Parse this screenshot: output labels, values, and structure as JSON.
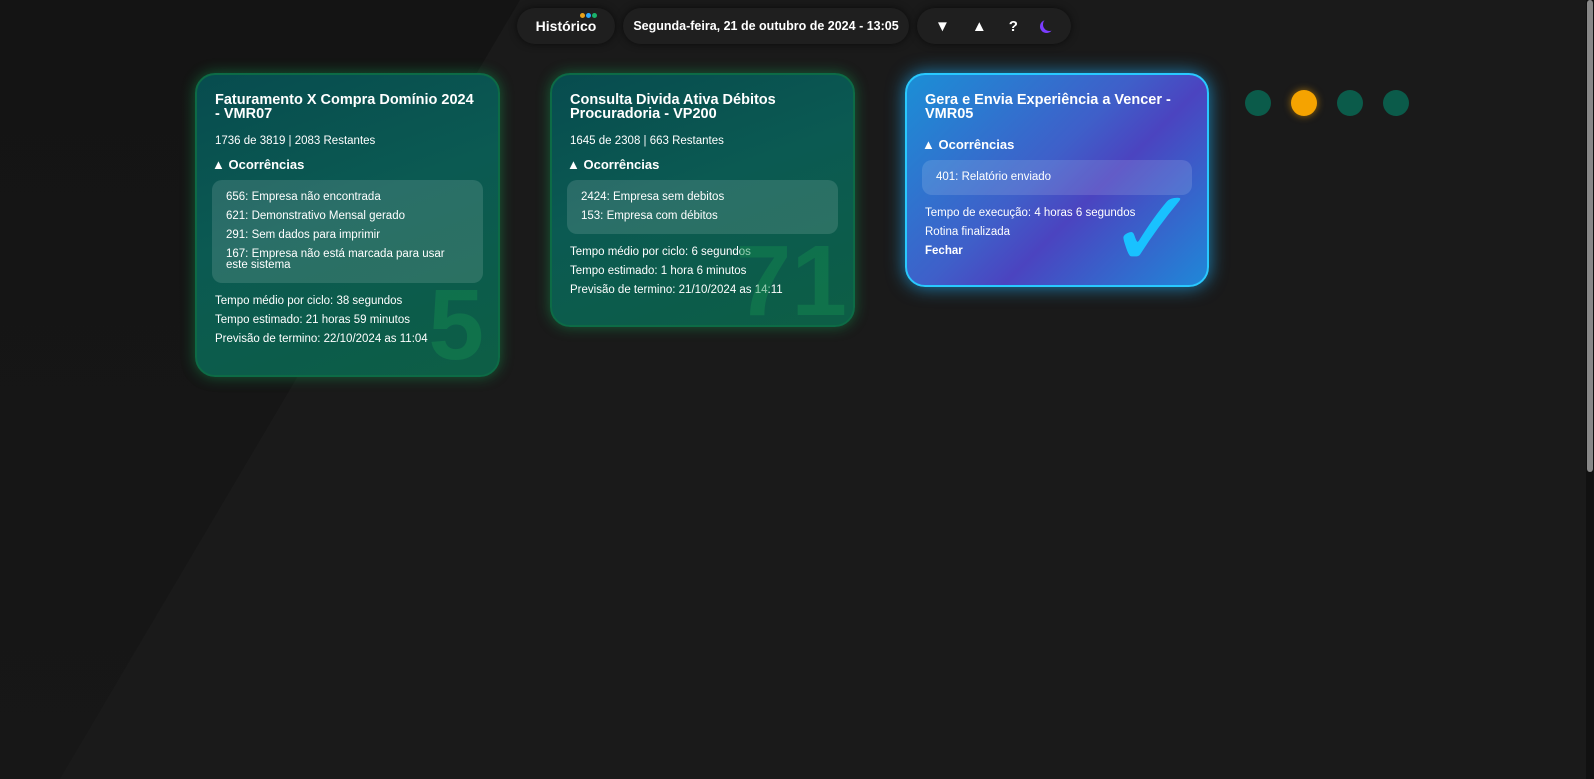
{
  "header": {
    "historico_label": "Histórico",
    "historico_dot_colors": [
      "#e8a21a",
      "#2aa8ff",
      "#19b36b"
    ],
    "date_label": "Segunda-feira, 21 de outubro de 2024 - 13:05",
    "tools": {
      "down": "▼",
      "up": "▲",
      "help": "?",
      "theme_icon": "moon-icon"
    }
  },
  "cards": [
    {
      "title": "Faturamento X Compra Domínio 2024 - VMR07",
      "count": "1736 de 3819 | 2083 Restantes",
      "occurrences_label": "▲ Ocorrências",
      "occurrences": [
        "656: Empresa não encontrada",
        "621: Demonstrativo Mensal gerado",
        "291: Sem dados para imprimir",
        "167: Empresa não está marcada para usar este sistema"
      ],
      "avg_cycle": "Tempo médio por ciclo: 38 segundos",
      "estimated": "Tempo estimado: 21 horas 59 minutos",
      "forecast": "Previsão de termino: 22/10/2024 as 11:04",
      "watermark": "5"
    },
    {
      "title": "Consulta Divida Ativa Débitos Procuradoria - VP200",
      "count": "1645 de 2308 | 663 Restantes",
      "occurrences_label": "▲ Ocorrências",
      "occurrences": [
        "2424: Empresa sem debitos",
        "153: Empresa com débitos"
      ],
      "avg_cycle": "Tempo médio por ciclo: 6 segundos",
      "estimated": "Tempo estimado: 1 hora 6 minutos",
      "forecast": "Previsão de termino: 21/10/2024 as 14:11",
      "watermark": "71"
    },
    {
      "title": "Gera e Envia Experiência a Vencer - VMR05",
      "occurrences_label": "▲ Ocorrências",
      "occurrences": [
        "401: Relatório enviado"
      ],
      "exec_time": "Tempo de execução: 4 horas 6 segundos",
      "status": "Rotina finalizada",
      "close_label": "Fechar"
    }
  ],
  "status_dots": [
    {
      "color": "#0b5b4a",
      "active": false
    },
    {
      "color": "#f5a300",
      "active": true
    },
    {
      "color": "#0b5b4a",
      "active": false
    },
    {
      "color": "#0b5b4a",
      "active": false
    }
  ]
}
